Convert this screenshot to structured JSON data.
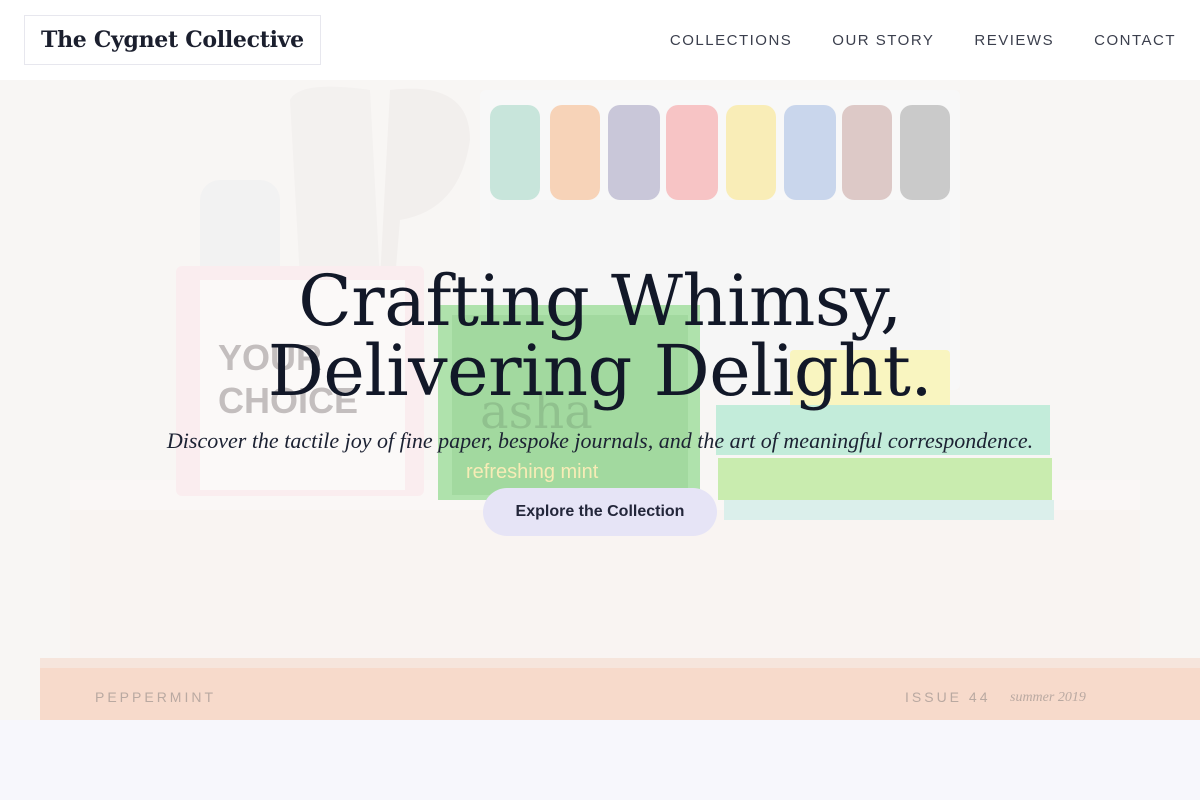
{
  "header": {
    "brand": "The Cygnet Collective",
    "nav": [
      {
        "label": "COLLECTIONS"
      },
      {
        "label": "OUR STORY"
      },
      {
        "label": "REVIEWS"
      },
      {
        "label": "CONTACT"
      }
    ]
  },
  "hero": {
    "title_line1": "Crafting Whimsy,",
    "title_line2": "Delivering Delight.",
    "subtitle": "Discover the tactile joy of fine paper, bespoke journals, and the art of meaningful correspondence.",
    "cta_label": "Explore the Collection",
    "photo_text": {
      "card_line1": "YOUR",
      "card_line2": "CHOICE",
      "tea_brand": "asha",
      "tea_flavor": "refreshing mint",
      "magazine_left": "PEPPERMINT",
      "magazine_issue": "ISSUE 44",
      "magazine_season": "summer 2019"
    }
  },
  "colors": {
    "accent_button": "#e6e4f6",
    "title": "#121828",
    "page_background": "#f7f7fb"
  }
}
